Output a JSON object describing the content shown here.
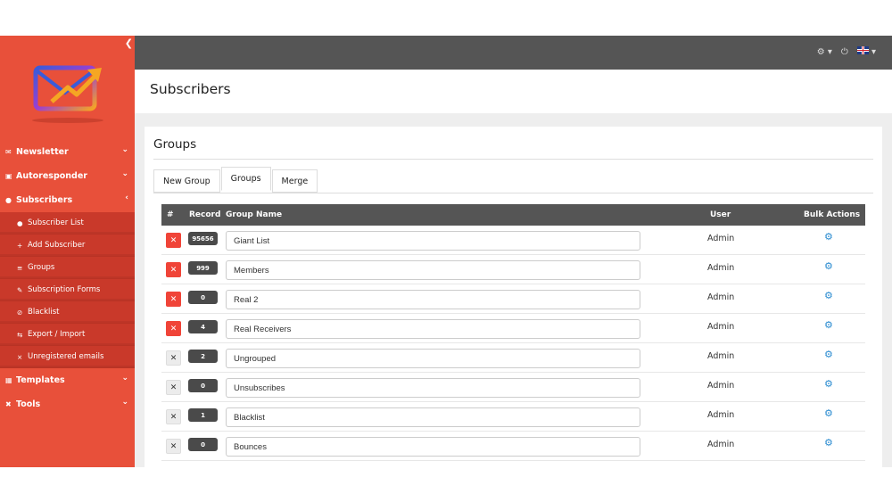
{
  "sidebar": {
    "collapse_icon": "chevron-left-icon",
    "logo_icon": "envelope-logo-icon",
    "items": [
      {
        "label": "Newsletter",
        "icon": "envelope-icon",
        "chevron": "chevron-down-icon"
      },
      {
        "label": "Autoresponder",
        "icon": "car-icon",
        "chevron": "chevron-down-icon"
      },
      {
        "label": "Subscribers",
        "icon": "users-icon",
        "chevron": "chevron-left-icon"
      },
      {
        "label": "Templates",
        "icon": "paint-roller-icon",
        "chevron": "chevron-down-icon"
      },
      {
        "label": "Tools",
        "icon": "tools-icon",
        "chevron": "chevron-down-icon"
      }
    ],
    "subitems": [
      {
        "label": "Subscriber List",
        "icon": "users-icon"
      },
      {
        "label": "Add Subscriber",
        "icon": "plus-icon"
      },
      {
        "label": "Groups",
        "icon": "list-icon"
      },
      {
        "label": "Subscription Forms",
        "icon": "edit-icon"
      },
      {
        "label": "Blacklist",
        "icon": "ban-icon"
      },
      {
        "label": "Export / Import",
        "icon": "exchange-icon"
      },
      {
        "label": "Unregistered emails",
        "icon": "user-slash-icon"
      }
    ]
  },
  "topbar": {
    "icons": [
      "gear-icon",
      "power-icon",
      "uk-flag-icon"
    ]
  },
  "page": {
    "title": "Subscribers"
  },
  "panel": {
    "title": "Groups",
    "tabs": [
      {
        "label": "New Group",
        "active": false
      },
      {
        "label": "Groups",
        "active": true
      },
      {
        "label": "Merge",
        "active": false
      }
    ]
  },
  "table": {
    "headers": {
      "num": "#",
      "record": "Record",
      "group_name": "Group Name",
      "user": "User",
      "bulk": "Bulk Actions"
    },
    "rows": [
      {
        "record": "95656",
        "name": "Giant List",
        "user": "Admin",
        "deletable": true
      },
      {
        "record": "999",
        "name": "Members",
        "user": "Admin",
        "deletable": true
      },
      {
        "record": "0",
        "name": "Real 2",
        "user": "Admin",
        "deletable": true
      },
      {
        "record": "4",
        "name": "Real Receivers",
        "user": "Admin",
        "deletable": true
      },
      {
        "record": "2",
        "name": "Ungrouped",
        "user": "Admin",
        "deletable": false
      },
      {
        "record": "0",
        "name": "Unsubscribes",
        "user": "Admin",
        "deletable": false
      },
      {
        "record": "1",
        "name": "Blacklist",
        "user": "Admin",
        "deletable": false
      },
      {
        "record": "0",
        "name": "Bounces",
        "user": "Admin",
        "deletable": false
      }
    ]
  },
  "colors": {
    "sidebar": "#e8503a",
    "submenu": "#c9392a",
    "topbar": "#555555",
    "delete_red": "#f04438",
    "gear_blue": "#2a8bd0"
  }
}
